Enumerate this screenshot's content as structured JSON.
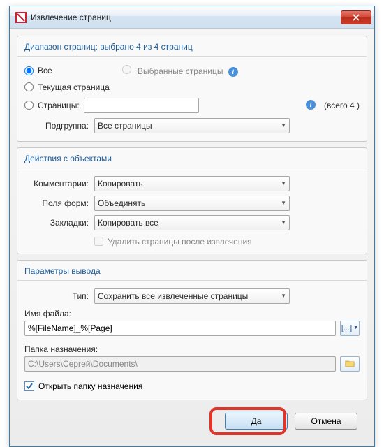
{
  "window": {
    "title": "Извлечение страниц"
  },
  "pageRange": {
    "header": "Диапазон страниц: выбрано 4 из 4 страниц",
    "all": "Все",
    "selected": "Выбранные страницы",
    "current": "Текущая страница",
    "pages": "Страницы:",
    "pagesValue": "",
    "total": "(всего  4 )",
    "subgroupLabel": "Подгруппа:",
    "subgroupValue": "Все страницы"
  },
  "actions": {
    "header": "Действия с объектами",
    "commentsLabel": "Комментарии:",
    "commentsValue": "Копировать",
    "formsLabel": "Поля форм:",
    "formsValue": "Объединять",
    "bookmarksLabel": "Закладки:",
    "bookmarksValue": "Копировать все",
    "deleteAfter": "Удалить страницы после извлечения"
  },
  "output": {
    "header": "Параметры вывода",
    "typeLabel": "Тип:",
    "typeValue": "Сохранить все извлеченные страницы",
    "filenameLabel": "Имя файла:",
    "filenameValue": "%[FileName]_%[Page]",
    "macroBtn": "[...]",
    "destLabel": "Папка назначения:",
    "destValue": "C:\\Users\\Сергей\\Documents\\",
    "openDest": "Открыть папку назначения"
  },
  "buttons": {
    "ok": "Да",
    "cancel": "Отмена"
  }
}
